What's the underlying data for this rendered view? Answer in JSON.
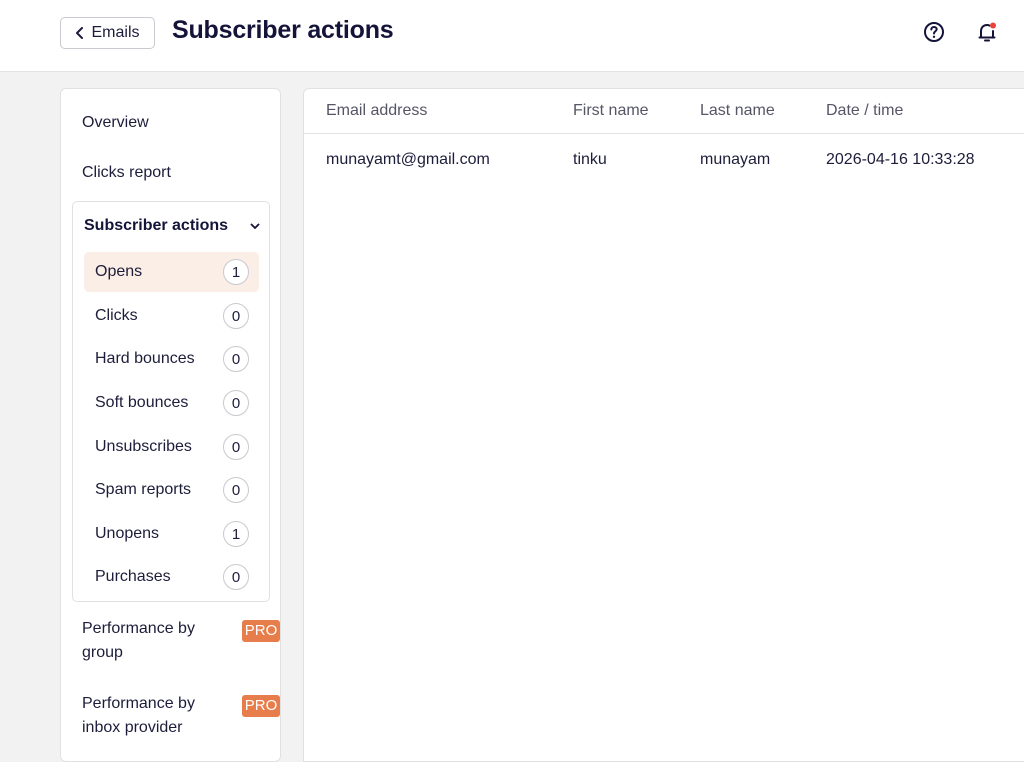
{
  "header": {
    "back_label": "Emails",
    "title": "Subscriber actions",
    "notification_dot_color": "#e8443a"
  },
  "sidebar": {
    "overview": "Overview",
    "clicks_report": "Clicks report",
    "group_title": "Subscriber actions",
    "items": [
      {
        "label": "Opens",
        "count": "1",
        "active": true
      },
      {
        "label": "Clicks",
        "count": "0"
      },
      {
        "label": "Hard bounces",
        "count": "0"
      },
      {
        "label": "Soft bounces",
        "count": "0"
      },
      {
        "label": "Unsubscribes",
        "count": "0"
      },
      {
        "label": "Spam reports",
        "count": "0"
      },
      {
        "label": "Unopens",
        "count": "1"
      },
      {
        "label": "Purchases",
        "count": "0"
      }
    ],
    "perf_group": {
      "label": "Performance by group",
      "badge": "PRO"
    },
    "perf_inbox": {
      "label": "Performance by inbox provider",
      "badge": "PRO"
    }
  },
  "table": {
    "columns": [
      "Email address",
      "First name",
      "Last name",
      "Date / time"
    ],
    "rows": [
      [
        "munayamt@gmail.com",
        "tinku",
        "munayam",
        "2026-04-16 10:33:28"
      ]
    ]
  },
  "colors": {
    "accent_pro": "#e77d4a",
    "active_item_bg": "#fbeee6"
  }
}
